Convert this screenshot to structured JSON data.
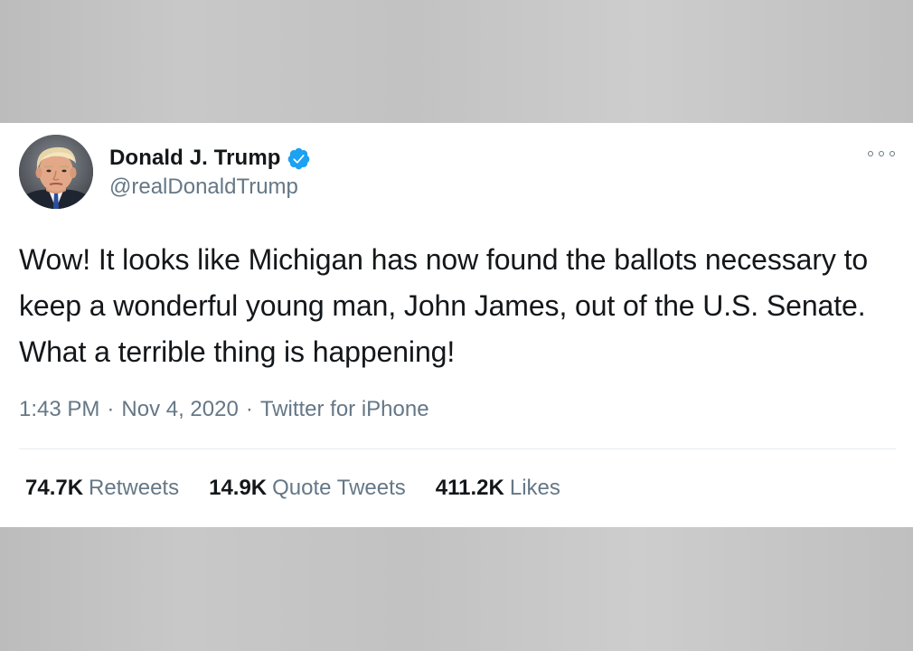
{
  "author": {
    "display_name": "Donald J. Trump",
    "handle": "@realDonaldTrump",
    "verified": true
  },
  "tweet": {
    "text": "Wow! It looks like Michigan has now found the ballots necessary to keep a wonderful young man, John James, out of the U.S. Senate. What a terrible thing is happening!",
    "time": "1:43 PM",
    "separator": "·",
    "date": "Nov 4, 2020",
    "source": "Twitter for iPhone"
  },
  "stats": {
    "retweets": {
      "value": "74.7K",
      "label": "Retweets"
    },
    "quote_tweets": {
      "value": "14.9K",
      "label": "Quote Tweets"
    },
    "likes": {
      "value": "411.2K",
      "label": "Likes"
    }
  },
  "icons": {
    "verified": "verified-badge-icon",
    "more": "more-options-icon"
  },
  "colors": {
    "verified_blue": "#1da1f2",
    "text_primary": "#14171a",
    "text_secondary": "#657786",
    "divider": "#e6ecf0",
    "background": "#c4c4c4"
  }
}
